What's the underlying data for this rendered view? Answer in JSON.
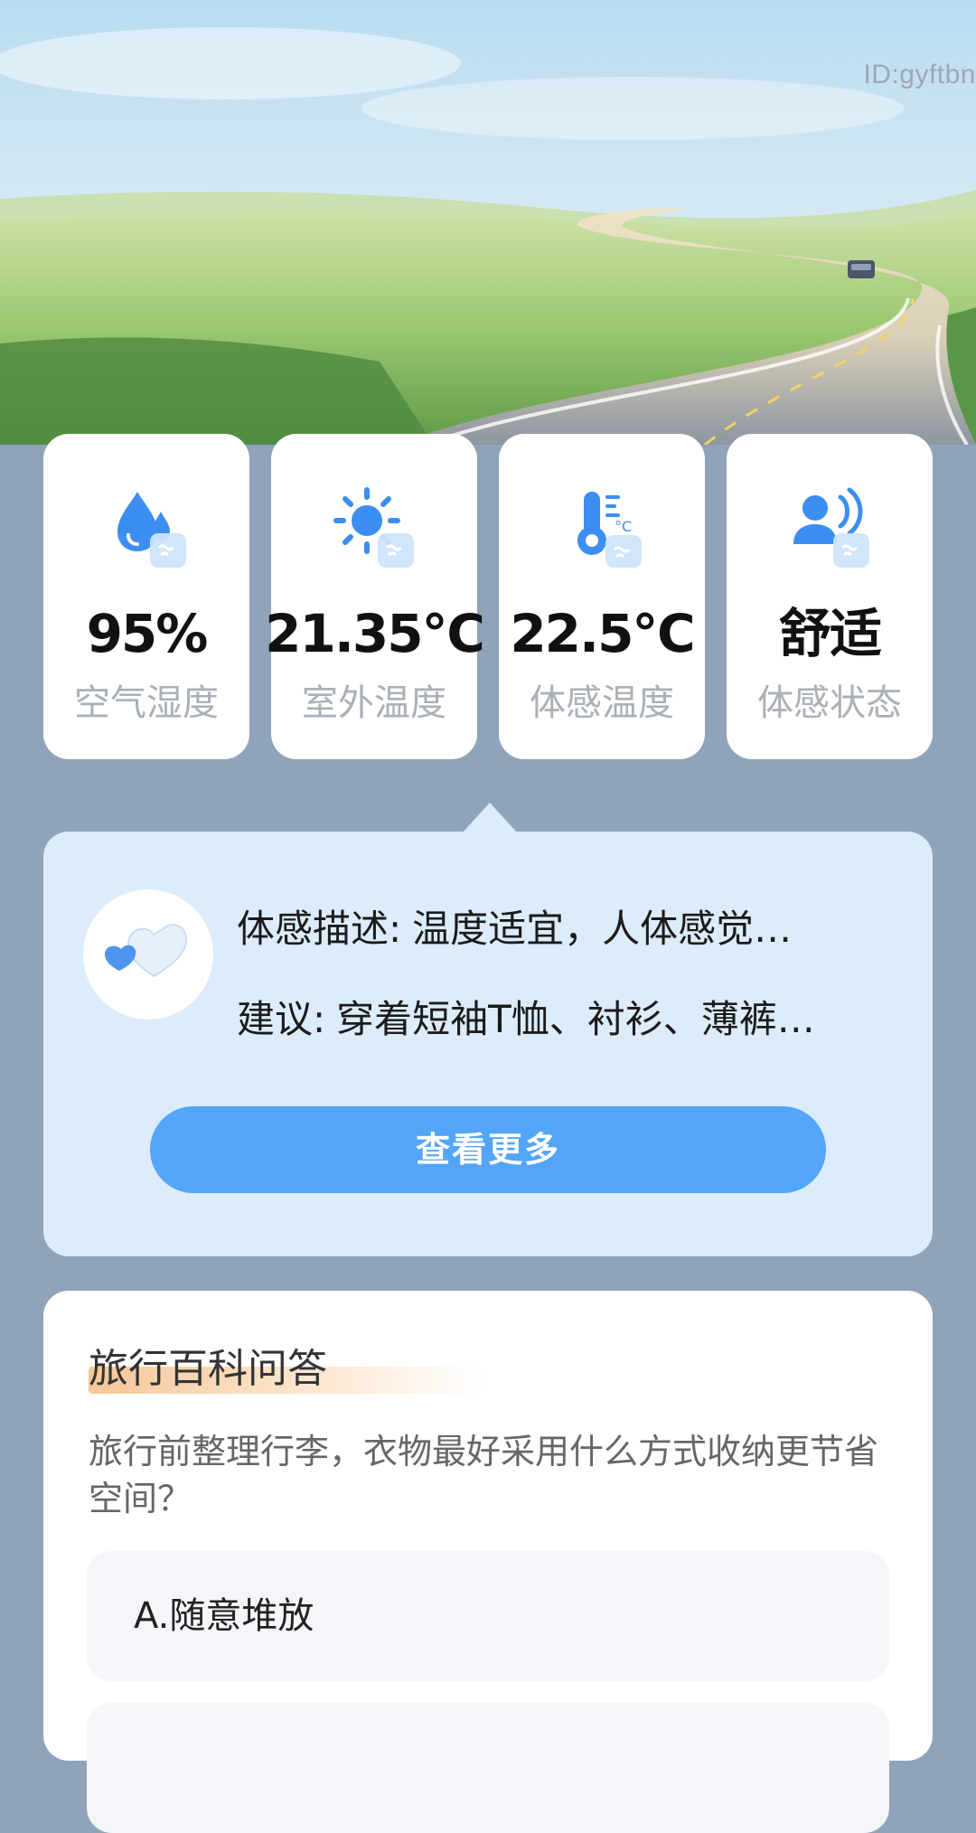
{
  "header": {
    "user_id": "ID:gyftbn"
  },
  "metrics": [
    {
      "icon": "humidity-icon",
      "value": "95%",
      "label": "空气湿度"
    },
    {
      "icon": "sun-icon",
      "value": "21.35℃",
      "label": "室外温度"
    },
    {
      "icon": "thermometer-icon",
      "value": "22.5℃",
      "label": "体感温度"
    },
    {
      "icon": "comfort-person-icon",
      "value": "舒适",
      "label": "体感状态"
    }
  ],
  "description": {
    "feel_label": "体感描述:",
    "feel_text": "温度适宜，人体感觉…",
    "advice_label": "建议:",
    "advice_text": "穿着短袖T恤、衬衫、薄裤…",
    "more_button": "查看更多"
  },
  "quiz": {
    "title": "旅行百科问答",
    "question": "旅行前整理行李，衣物最好采用什么方式收纳更节省空间？",
    "options": [
      "A.随意堆放",
      ""
    ]
  },
  "colors": {
    "page_bg": "#8fa3bb",
    "accent_blue": "#53a5f7",
    "panel_blue": "#dcecfb",
    "icon_blue": "#3c8ef0",
    "title_underline": "#f6c69a"
  }
}
